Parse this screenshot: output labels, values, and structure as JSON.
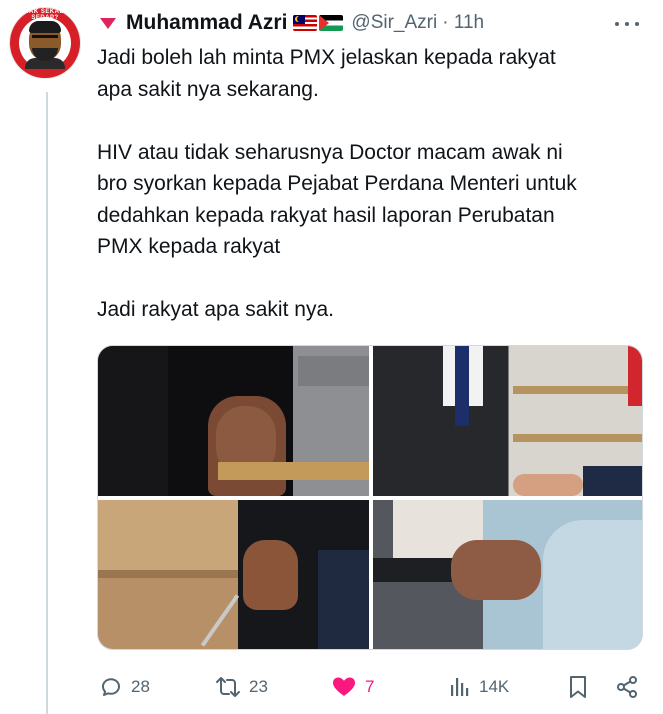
{
  "author": {
    "name": "Muhammad Azri",
    "handle": "@Sir_Azri",
    "time": "· 11h",
    "flags": [
      "malaysia-flag-icon",
      "palestine-flag-icon"
    ],
    "avatar_ring_text": "NAK SEKALI SEDAP?"
  },
  "tweet": {
    "paragraphs": [
      [
        "Jadi boleh lah minta PMX jelaskan kepada rakyat",
        "apa sakit nya sekarang."
      ],
      [
        "HIV atau tidak seharusnya Doctor macam awak ni",
        "bro syorkan kepada Pejabat Perdana Menteri untuk",
        "dedahkan kepada rakyat hasil laporan Perubatan",
        "PMX kepada rakyat"
      ],
      [
        "Jadi rakyat apa sakit nya."
      ]
    ]
  },
  "media": {
    "count": 4
  },
  "actions": {
    "replies": "28",
    "reposts": "23",
    "likes": "7",
    "views": "14K"
  },
  "colors": {
    "like_active": "#f91880",
    "icon_gray": "#536471",
    "caret_red": "#e0245e"
  }
}
